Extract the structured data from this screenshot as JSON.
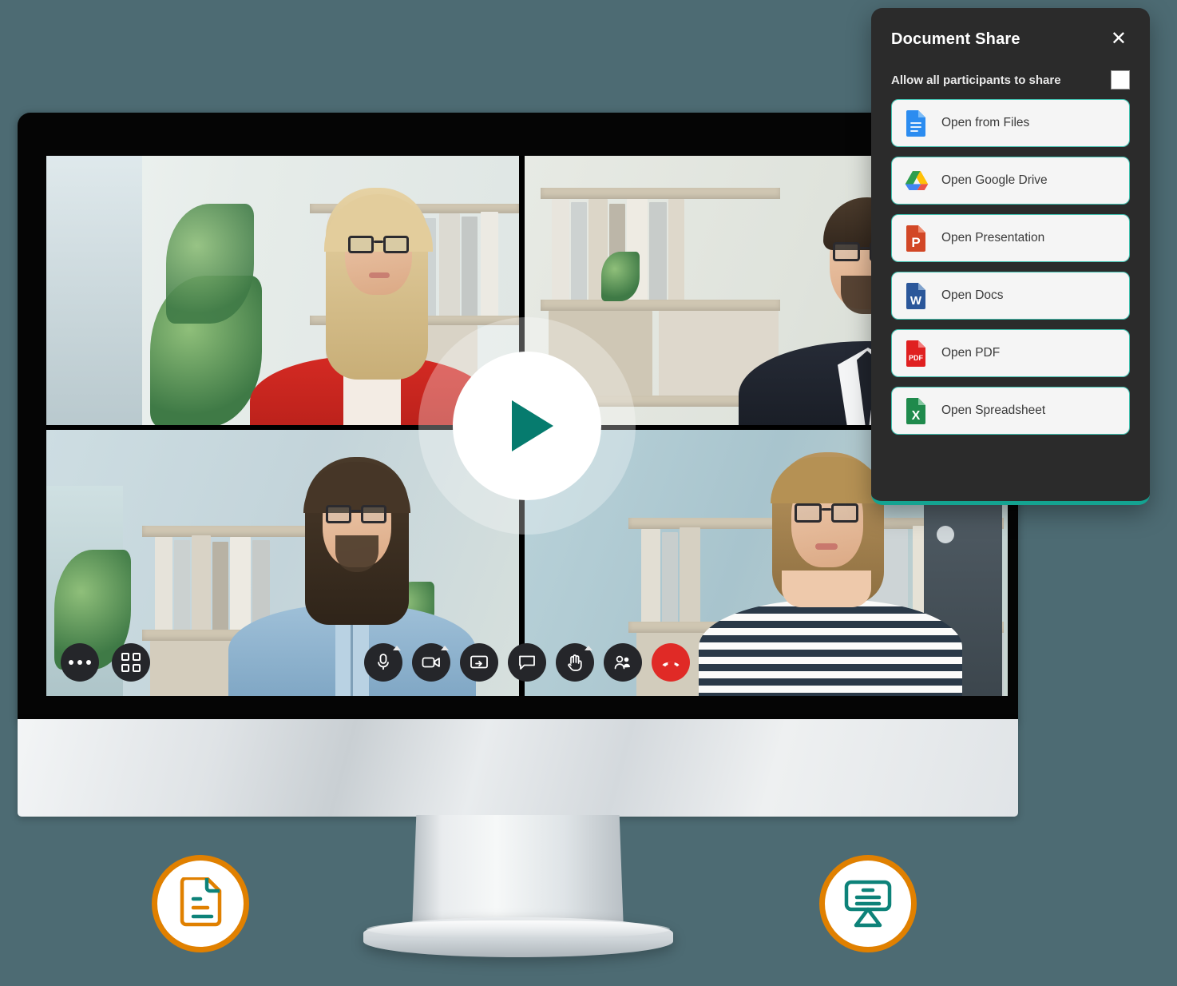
{
  "theme": {
    "page_background": "#4d6b73",
    "accent_teal": "#067b6e",
    "accent_orange": "#e08000",
    "panel_background": "#2b2b2b",
    "panel_accent": "#14a391",
    "end_call_red": "#e02a26"
  },
  "panel": {
    "title": "Document Share",
    "close_label": "✕",
    "allow_all_label": "Allow all participants to share",
    "allow_all_checked": false,
    "items": [
      {
        "label": "Open from Files",
        "icon": "google-docs-file-icon",
        "color": "#2b8cf0"
      },
      {
        "label": "Open Google Drive",
        "icon": "google-drive-icon",
        "color": "#34a853"
      },
      {
        "label": "Open Presentation",
        "icon": "powerpoint-file-icon",
        "color": "#d24726"
      },
      {
        "label": "Open Docs",
        "icon": "word-file-icon",
        "color": "#2b579a"
      },
      {
        "label": "Open PDF",
        "icon": "pdf-file-icon",
        "color": "#e02020"
      },
      {
        "label": "Open Spreadsheet",
        "icon": "excel-file-icon",
        "color": "#1f8a4c"
      }
    ]
  },
  "video_call": {
    "play_button_label": "Play",
    "participants": [
      {
        "id": "p1",
        "position": "top-left",
        "description": "Blonde woman with glasses in red blazer"
      },
      {
        "id": "p2",
        "position": "top-right",
        "description": "Bearded man with glasses in dark suit"
      },
      {
        "id": "p3",
        "position": "bottom-left",
        "description": "Long-haired man with glasses in blue shirt"
      },
      {
        "id": "p4",
        "position": "bottom-right",
        "description": "Woman with glasses in striped top"
      }
    ],
    "left_controls": [
      {
        "name": "more-options",
        "icon": "ellipsis-icon"
      },
      {
        "name": "grid-view",
        "icon": "grid-view-icon"
      }
    ],
    "center_controls": [
      {
        "name": "microphone",
        "icon": "microphone-icon",
        "has_caret": true,
        "danger": false
      },
      {
        "name": "camera",
        "icon": "video-camera-icon",
        "has_caret": true,
        "danger": false
      },
      {
        "name": "share-screen",
        "icon": "screen-share-icon",
        "has_caret": false,
        "danger": false
      },
      {
        "name": "chat",
        "icon": "chat-bubble-icon",
        "has_caret": false,
        "danger": false
      },
      {
        "name": "raise-hand",
        "icon": "raise-hand-icon",
        "has_caret": true,
        "danger": false
      },
      {
        "name": "participants",
        "icon": "participants-icon",
        "has_caret": false,
        "danger": false
      },
      {
        "name": "end-call",
        "icon": "end-call-icon",
        "has_caret": false,
        "danger": true
      }
    ]
  },
  "feature_badges": [
    {
      "name": "document-badge",
      "icon": "document-page-icon",
      "ring_color": "#e08000"
    },
    {
      "name": "presentation-badge",
      "icon": "presentation-board-icon",
      "ring_color": "#e08000"
    }
  ]
}
